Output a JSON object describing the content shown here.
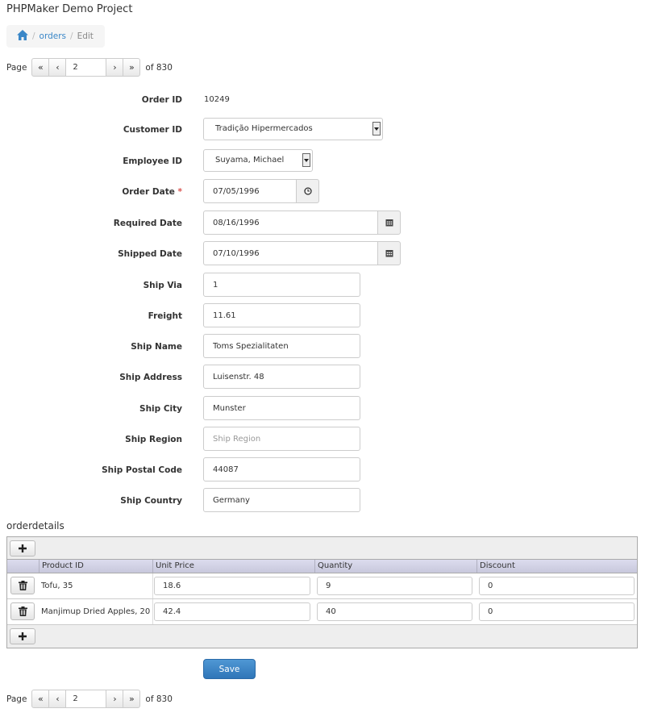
{
  "app": {
    "title": "PHPMaker Demo Project"
  },
  "breadcrumb": {
    "home_icon": "home-icon",
    "link": "orders",
    "separator": "/",
    "current": "Edit"
  },
  "pager": {
    "label": "Page",
    "first": "«",
    "prev": "‹",
    "current_page": "2",
    "next": "›",
    "last": "»",
    "total": "of 830"
  },
  "form": {
    "order_id": {
      "label": "Order ID",
      "value": "10249"
    },
    "customer_id": {
      "label": "Customer ID",
      "value": "Tradição Hipermercados"
    },
    "employee_id": {
      "label": "Employee ID",
      "value": "Suyama, Michael"
    },
    "order_date": {
      "label": "Order Date",
      "required_mark": "*",
      "value": "07/05/1996",
      "icon": "clock-icon"
    },
    "required_date": {
      "label": "Required Date",
      "value": "08/16/1996",
      "icon": "calendar-icon"
    },
    "shipped_date": {
      "label": "Shipped Date",
      "value": "07/10/1996",
      "icon": "calendar-icon"
    },
    "ship_via": {
      "label": "Ship Via",
      "value": "1"
    },
    "freight": {
      "label": "Freight",
      "value": "11.61"
    },
    "ship_name": {
      "label": "Ship Name",
      "value": "Toms Spezialitaten"
    },
    "ship_address": {
      "label": "Ship Address",
      "value": "Luisenstr. 48"
    },
    "ship_city": {
      "label": "Ship City",
      "value": "Munster"
    },
    "ship_region": {
      "label": "Ship Region",
      "value": "",
      "placeholder": "Ship Region"
    },
    "ship_postal_code": {
      "label": "Ship Postal Code",
      "value": "44087"
    },
    "ship_country": {
      "label": "Ship Country",
      "value": "Germany"
    }
  },
  "details": {
    "title": "orderdetails",
    "add_icon": "plus-icon",
    "delete_icon": "trash-icon",
    "columns": [
      "Product ID",
      "Unit Price",
      "Quantity",
      "Discount"
    ],
    "rows": [
      {
        "product": "Tofu, 35",
        "unit_price": "18.6",
        "quantity": "9",
        "discount": "0"
      },
      {
        "product": "Manjimup Dried Apples, 20",
        "unit_price": "42.4",
        "quantity": "40",
        "discount": "0"
      }
    ]
  },
  "actions": {
    "save_label": "Save"
  }
}
